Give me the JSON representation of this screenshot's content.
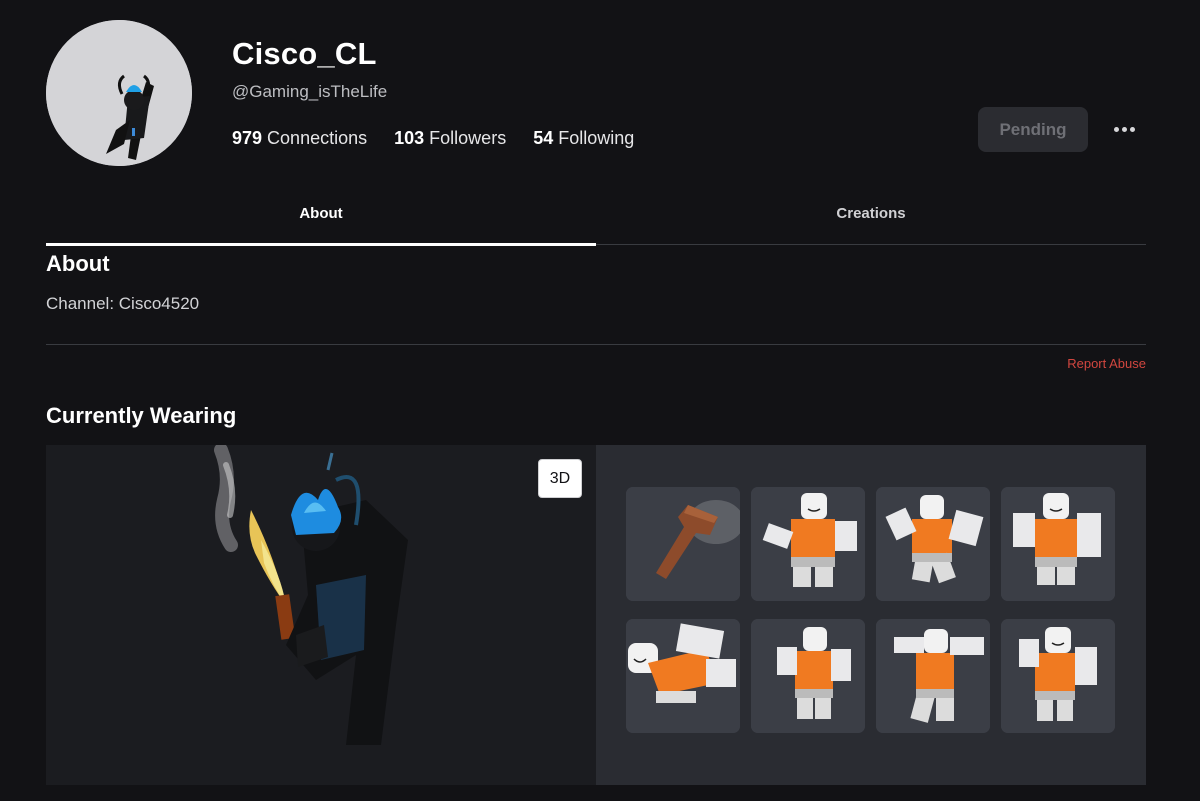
{
  "profile": {
    "display_name": "Cisco_CL",
    "username": "@Gaming_isTheLife",
    "stats": [
      {
        "count": "979",
        "label": "Connections"
      },
      {
        "count": "103",
        "label": "Followers"
      },
      {
        "count": "54",
        "label": "Following"
      }
    ],
    "pending_label": "Pending"
  },
  "tabs": [
    {
      "label": "About",
      "active": true
    },
    {
      "label": "Creations",
      "active": false
    }
  ],
  "about": {
    "heading": "About",
    "text": "Channel: Cisco4520",
    "report_label": "Report Abuse"
  },
  "wearing": {
    "heading": "Currently Wearing",
    "view_toggle_label": "3D",
    "items": [
      {
        "name": "rusty-tool-item",
        "icon": "rusty-spike-icon"
      },
      {
        "name": "animation-item-1",
        "icon": "avatar-pose-icon"
      },
      {
        "name": "animation-item-2",
        "icon": "avatar-pose-icon"
      },
      {
        "name": "animation-item-3",
        "icon": "avatar-pose-icon"
      },
      {
        "name": "animation-item-4",
        "icon": "avatar-pose-icon"
      },
      {
        "name": "animation-item-5",
        "icon": "avatar-pose-icon"
      },
      {
        "name": "animation-item-6",
        "icon": "avatar-pose-icon"
      },
      {
        "name": "animation-item-7",
        "icon": "avatar-pose-icon"
      }
    ]
  },
  "colors": {
    "background": "#121215",
    "report_red": "#d1463f",
    "tile": "#3b3e46",
    "shirt_orange": "#f07a21"
  }
}
